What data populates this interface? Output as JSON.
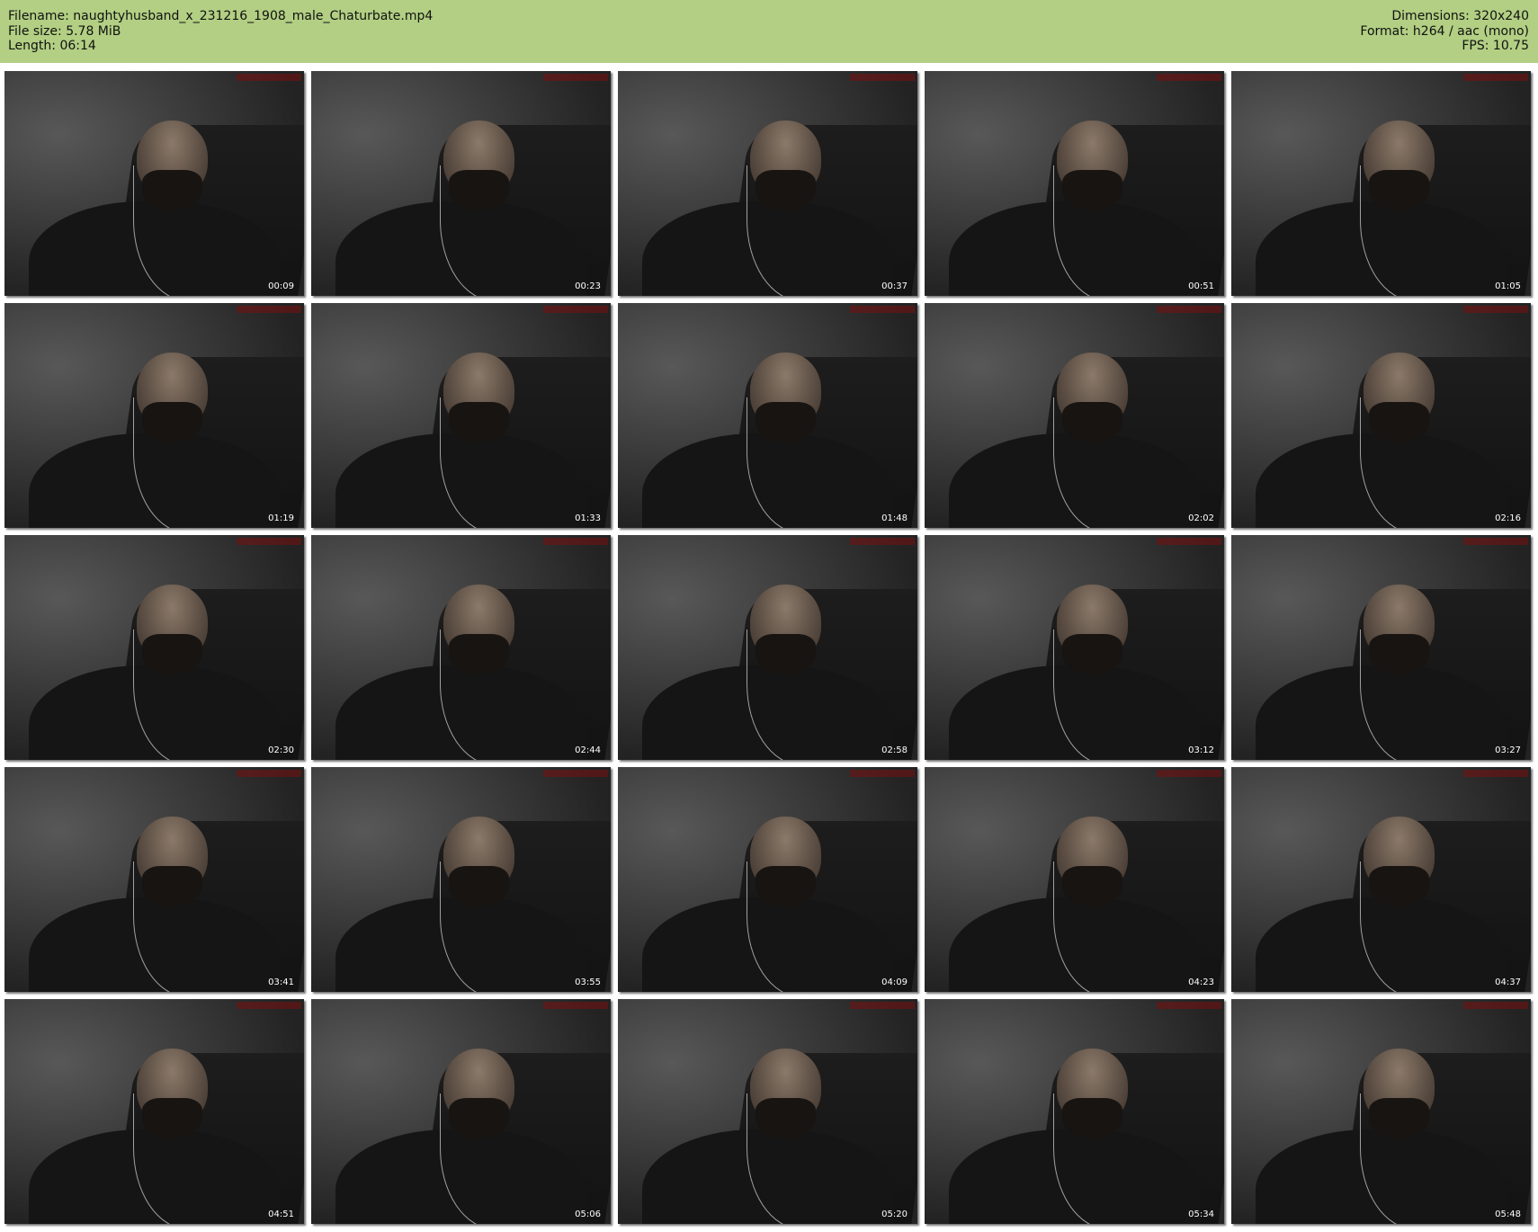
{
  "header": {
    "filename_line": "Filename: naughtyhusband_x_231216_1908_male_Chaturbate.mp4",
    "filesize_line": "File size: 5.78 MiB",
    "length_line": "Length: 06:14",
    "dimensions_line": "Dimensions: 320x240",
    "format_line": "Format: h264 / aac (mono)",
    "fps_line": "FPS: 10.75"
  },
  "colors": {
    "header_background": "#b2cf83",
    "page_background": "#ffffff",
    "timestamp_text": "#ffffff"
  },
  "thumbnails": [
    {
      "timestamp": "00:09"
    },
    {
      "timestamp": "00:23"
    },
    {
      "timestamp": "00:37"
    },
    {
      "timestamp": "00:51"
    },
    {
      "timestamp": "01:05"
    },
    {
      "timestamp": "01:19"
    },
    {
      "timestamp": "01:33"
    },
    {
      "timestamp": "01:48"
    },
    {
      "timestamp": "02:02"
    },
    {
      "timestamp": "02:16"
    },
    {
      "timestamp": "02:30"
    },
    {
      "timestamp": "02:44"
    },
    {
      "timestamp": "02:58"
    },
    {
      "timestamp": "03:12"
    },
    {
      "timestamp": "03:27"
    },
    {
      "timestamp": "03:41"
    },
    {
      "timestamp": "03:55"
    },
    {
      "timestamp": "04:09"
    },
    {
      "timestamp": "04:23"
    },
    {
      "timestamp": "04:37"
    },
    {
      "timestamp": "04:51"
    },
    {
      "timestamp": "05:06"
    },
    {
      "timestamp": "05:20"
    },
    {
      "timestamp": "05:34"
    },
    {
      "timestamp": "05:48"
    }
  ]
}
